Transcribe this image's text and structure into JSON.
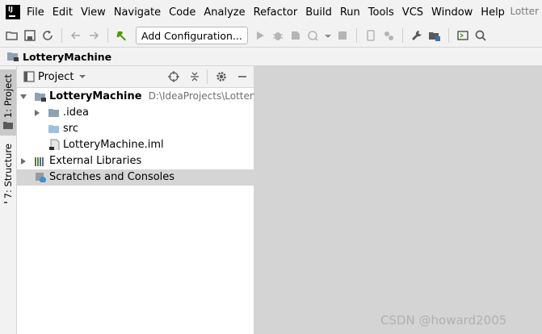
{
  "app": {
    "logo_text": "IJ",
    "title_right": "Lotter"
  },
  "menu": [
    "File",
    "Edit",
    "View",
    "Navigate",
    "Code",
    "Analyze",
    "Refactor",
    "Build",
    "Run",
    "Tools",
    "VCS",
    "Window",
    "Help"
  ],
  "toolbar": {
    "add_configuration_label": "Add Configuration...",
    "icons": [
      "folder-open-icon",
      "save-icon",
      "sync-icon",
      "back-icon",
      "forward-icon",
      "build-hammer-icon",
      "run-icon",
      "debug-icon",
      "coverage-icon",
      "profile-icon",
      "dropdown-icon",
      "stop-icon",
      "device-icon",
      "vcs-update-icon",
      "wrench-icon",
      "project-structure-icon",
      "terminal-icon",
      "search-icon"
    ]
  },
  "navbar": {
    "crumb": "LotteryMachine"
  },
  "left_strip": {
    "tabs": [
      {
        "label": "1: Project",
        "active": true
      },
      {
        "label": "7: Structure",
        "active": false
      }
    ]
  },
  "project_panel": {
    "title": "Project",
    "tree": [
      {
        "label": "LotteryMachine",
        "path": "D:\\IdeaProjects\\LotteryMa",
        "type": "module",
        "expanded": true,
        "level": 0
      },
      {
        "label": ".idea",
        "type": "folder",
        "expanded": false,
        "level": 1
      },
      {
        "label": "src",
        "type": "folder",
        "level": 1
      },
      {
        "label": "LotteryMachine.iml",
        "type": "file",
        "level": 1
      },
      {
        "label": "External Libraries",
        "type": "libraries",
        "expanded": false,
        "level": 0
      },
      {
        "label": "Scratches and Consoles",
        "type": "scratches",
        "level": 0,
        "selected": true
      }
    ]
  },
  "colors": {
    "accent_green": "#4e9a06",
    "folder": "#8da2b5",
    "editor_bg": "#d4d4d4"
  },
  "watermark": "CSDN @howard2005"
}
